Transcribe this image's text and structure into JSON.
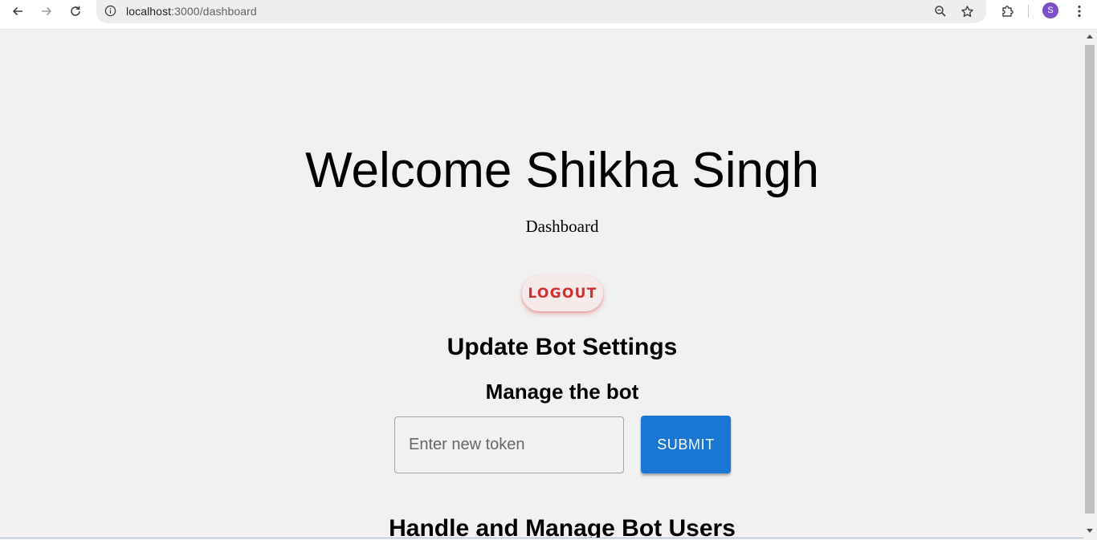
{
  "browser": {
    "url_host": "localhost",
    "url_path": ":3000/dashboard",
    "profile_initial": "S",
    "icons": {
      "back": "arrow-left-icon",
      "forward": "arrow-right-icon",
      "reload": "reload-icon",
      "site_info": "info-icon",
      "zoom": "zoom-icon",
      "bookmark": "star-icon",
      "extensions": "puzzle-icon",
      "menu": "kebab-menu-icon"
    },
    "colors": {
      "avatar": "#7b4fc7"
    }
  },
  "page": {
    "welcome": "Welcome Shikha Singh",
    "subtitle": "Dashboard",
    "logout_label": "LOGOUT",
    "update_heading": "Update Bot Settings",
    "manage_heading": "Manage the bot",
    "token_placeholder": "Enter new token",
    "token_value": "",
    "submit_label": "SUBMIT",
    "handle_heading": "Handle and Manage Bot Users",
    "colors": {
      "logout_text": "#d32f2f",
      "submit_bg": "#1976d2",
      "page_bg": "#f1f1f1"
    }
  }
}
